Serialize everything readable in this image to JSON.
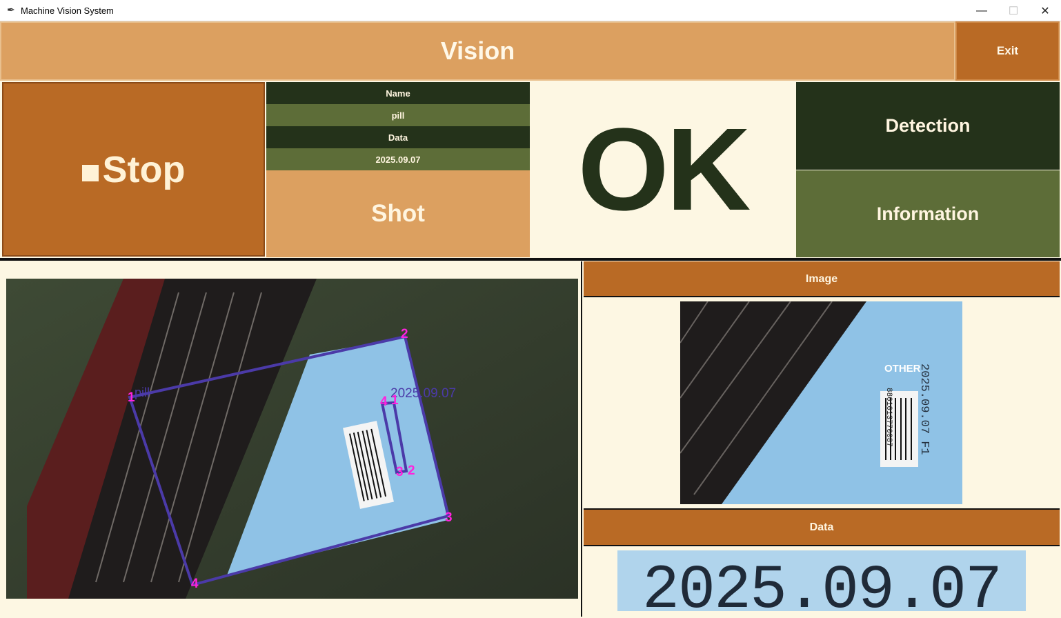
{
  "window": {
    "title": "Machine Vision System",
    "minimize": "—",
    "maximize": "☐",
    "close": "✕"
  },
  "header": {
    "title": "Vision",
    "exit_label": "Exit"
  },
  "controls": {
    "stop_label": "Stop",
    "shot_label": "Shot",
    "detection_label": "Detection",
    "information_label": "Information"
  },
  "info": {
    "name_label": "Name",
    "name_value": "pill",
    "data_label": "Data",
    "data_value": "2025.09.07"
  },
  "result": {
    "status": "OK"
  },
  "panels": {
    "image_label": "Image",
    "data_label": "Data"
  },
  "camera": {
    "object_label": "pill",
    "date_label": "2025.09.07",
    "outer_corners": [
      "1",
      "2",
      "3",
      "4"
    ],
    "inner_corners": [
      "4",
      "1",
      "3",
      "2"
    ]
  },
  "thumbnail": {
    "date_text": "2025.09.07 F1",
    "logo_text": "OTHER",
    "barcode": "8801013770087"
  },
  "crop": {
    "text": "2025.09.07"
  },
  "colors": {
    "dark_green": "#24321a",
    "olive": "#5d6d38",
    "orange": "#b96a25",
    "tan": "#dca060",
    "cream": "#fdf7e3",
    "box": "#4b3aa8",
    "corner": "#ff22dd"
  },
  "icons": [
    "feather-icon",
    "minimize-icon",
    "maximize-icon",
    "close-icon",
    "stop-square-icon"
  ]
}
